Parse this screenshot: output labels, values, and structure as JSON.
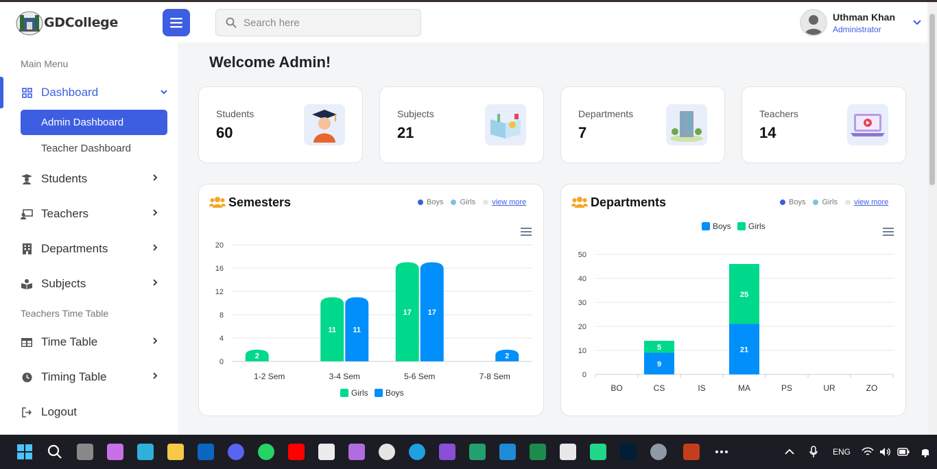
{
  "header": {
    "logo_text": "GDCollege",
    "search_placeholder": "Search here",
    "user_name": "Uthman Khan",
    "user_role": "Administrator"
  },
  "sidebar": {
    "section_main": "Main Menu",
    "dashboard": "Dashboard",
    "admin_dashboard": "Admin Dashboard",
    "teacher_dashboard": "Teacher Dashboard",
    "students": "Students",
    "teachers": "Teachers",
    "departments": "Departments",
    "subjects": "Subjects",
    "section_timetable": "Teachers Time Table",
    "time_table": "Time Table",
    "timing_table": "Timing Table",
    "logout": "Logout"
  },
  "main": {
    "welcome": "Welcome Admin!",
    "cards": [
      {
        "label": "Students",
        "value": "60"
      },
      {
        "label": "Subjects",
        "value": "21"
      },
      {
        "label": "Departments",
        "value": "7"
      },
      {
        "label": "Teachers",
        "value": "14"
      }
    ],
    "top_legend": {
      "boys": "Boys",
      "girls": "Girls",
      "view_more": "view more"
    }
  },
  "colors": {
    "accent": "#3d5ee1",
    "girls": "#00d98b",
    "boys": "#008ffb"
  },
  "chart_data": [
    {
      "type": "bar",
      "title": "Semesters",
      "categories": [
        "1-2 Sem",
        "3-4 Sem",
        "5-6 Sem",
        "7-8 Sem"
      ],
      "series": [
        {
          "name": "Girls",
          "values": [
            2,
            11,
            17,
            0
          ]
        },
        {
          "name": "Boys",
          "values": [
            0,
            11,
            17,
            2
          ]
        }
      ],
      "ylim": [
        0,
        20
      ],
      "yticks": [
        0,
        4,
        8,
        12,
        16,
        20
      ],
      "legend": "bottom",
      "grid": true
    },
    {
      "type": "bar",
      "stacked": true,
      "title": "Departments",
      "categories": [
        "BO",
        "CS",
        "IS",
        "MA",
        "PS",
        "UR",
        "ZO"
      ],
      "series": [
        {
          "name": "Boys",
          "values": [
            0,
            9,
            0,
            21,
            0,
            0,
            0
          ]
        },
        {
          "name": "Girls",
          "values": [
            0,
            5,
            0,
            25,
            0,
            0,
            0
          ]
        }
      ],
      "ylim": [
        0,
        50
      ],
      "yticks": [
        0,
        10,
        20,
        30,
        40,
        50
      ],
      "legend": "top",
      "grid": true
    }
  ],
  "tray": {
    "lang": "ENG"
  }
}
